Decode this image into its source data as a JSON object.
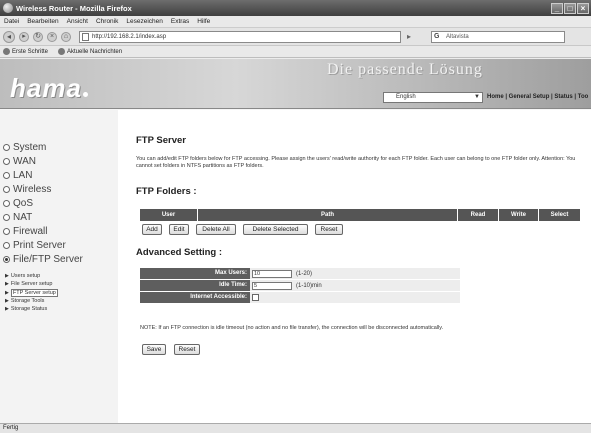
{
  "window": {
    "title": "Wireless Router - Mozilla Firefox"
  },
  "menu": [
    "Datei",
    "Bearbeiten",
    "Ansicht",
    "Chronik",
    "Lesezeichen",
    "Extras",
    "Hilfe"
  ],
  "nav": {
    "url": "http://192.168.2.1/index.asp",
    "search_placeholder": "Altavista"
  },
  "bookmarks": [
    "Erste Schritte",
    "Aktuelle Nachrichten"
  ],
  "header": {
    "logo": "hama",
    "slogan": "Die passende Lösung",
    "language": "English",
    "links": "Home | General Setup | Status | Too"
  },
  "sidebar": {
    "items": [
      "System",
      "WAN",
      "LAN",
      "Wireless",
      "QoS",
      "NAT",
      "Firewall",
      "Print Server",
      "File/FTP Server"
    ],
    "sub_items": [
      "Users setup",
      "File Server setup",
      "FTP Server setup",
      "Storage Tools",
      "Storage Status"
    ]
  },
  "main": {
    "title": "FTP Server",
    "description": "You can add/edit FTP folders below for FTP accessing. Please assign the users' read/write authority for each FTP folder. Each user can belong to one FTP folder only. Attention: You cannot set folders in NTFS partitions as FTP folders.",
    "folders_title": "FTP Folders :",
    "columns": [
      "User",
      "Path",
      "Read",
      "Write",
      "Select"
    ],
    "buttons": {
      "add": "Add",
      "edit": "Edit",
      "delete_all": "Delete All",
      "delete_selected": "Delete Selected",
      "reset": "Reset"
    },
    "advanced_title": "Advanced Setting :",
    "max_users": {
      "label": "Max Users:",
      "value": "10",
      "hint": "(1-20)"
    },
    "idle_time": {
      "label": "Idle Time:",
      "value": "5",
      "hint": "(1-10)min"
    },
    "internet_accessible": {
      "label": "Internet Accessible:",
      "checked": false
    },
    "note": "NOTE: If an FTP connection is idle timeout (no action and no file transfer), the connection will be disconnected automatically.",
    "save": "Save",
    "reset2": "Reset"
  },
  "status": "Fertig"
}
